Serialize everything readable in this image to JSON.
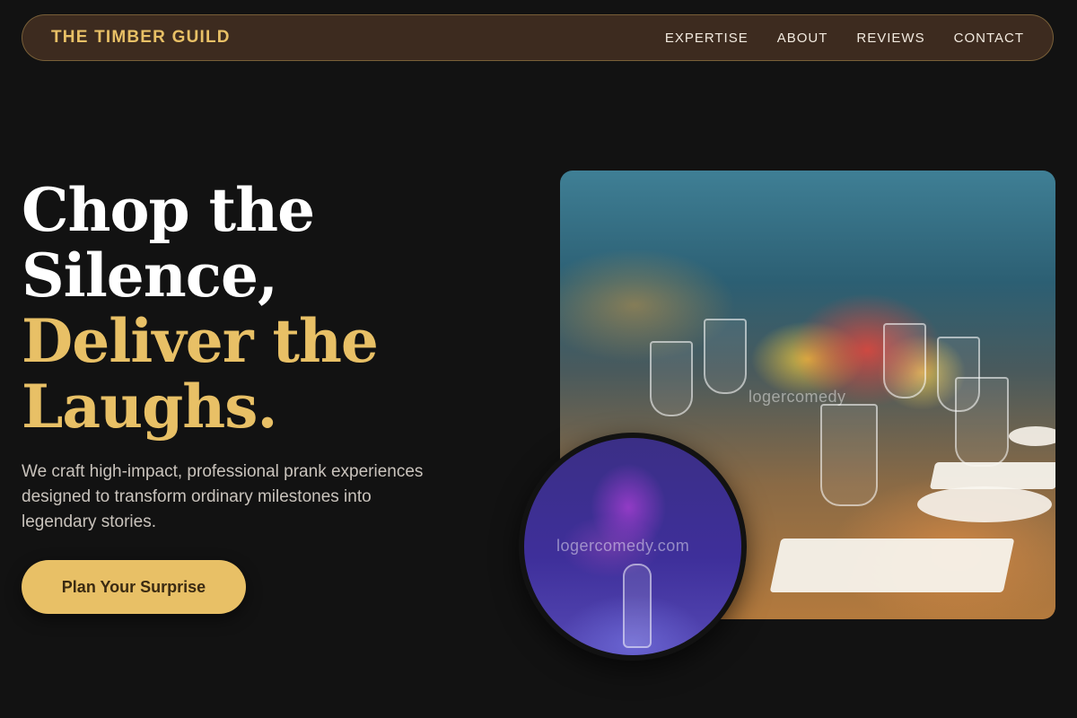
{
  "nav": {
    "brand": "THE TIMBER GUILD",
    "links": [
      "EXPERTISE",
      "ABOUT",
      "REVIEWS",
      "CONTACT"
    ]
  },
  "hero": {
    "headline_line1": "Chop the",
    "headline_line2": "Silence,",
    "headline_line3": "Deliver the",
    "headline_line4": "Laughs.",
    "subtitle": "We craft high-impact, professional prank experiences designed to transform ordinary milestones into legendary stories.",
    "cta_label": "Plan Your Surprise"
  },
  "images": {
    "main_watermark": "logercomedy",
    "circle_watermark": "logercomedy.com"
  },
  "colors": {
    "background": "#121212",
    "nav_background": "#3d2b1f",
    "accent_gold": "#e8c066",
    "text_white": "#ffffff",
    "text_muted": "#c9c3bc"
  }
}
